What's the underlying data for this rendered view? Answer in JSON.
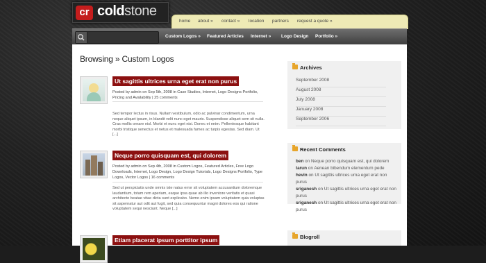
{
  "logo": {
    "mark": "cr",
    "word_a": "cold",
    "word_b": "stone"
  },
  "topnav": [
    "home",
    "about »",
    "contact »",
    "location",
    "partners",
    "request a quote »"
  ],
  "mainnav": [
    "Custom Logos »",
    "Featured Articles",
    "Internet »",
    "Logo Design",
    "Portfolio »"
  ],
  "page_title": "Browsing » Custom Logos",
  "posts": [
    {
      "title": "Ut sagittis ultrices urna eget erat non purus",
      "meta": "Posted by admin on Sep 5th, 2008 in Case Studies, Internet, Logo Designs Portfolio, Pricing and Availability | 25 comments",
      "excerpt": "Sed tempor lectus in risus. Nullam vestibulum, odio ac pulvinar condimentum, urna neque aliquet ipsum, in blandit velit nunc eget mauris. Suspendisse aliquet sem sit nulla. Cras mollis ornare nisl. Morbi et nunc eget nisi. Donec et enim. Pellentesque habitant morbi tristique senectus et netus et malesuada fames ac turpis egestas. Sed diam. Ut [...]"
    },
    {
      "title": "Neque porro quisquam est, qui dolorem",
      "meta": "Posted by admin on Sep 4th, 2008 in Custom Logos, Featured Articles, Free Logo Downloads, Internet, Logo Design, Logo Design Tutorials, Logo Designs Portfolio, Type Logos, Vector Logos | 16 comments",
      "excerpt": "Sed ut perspiciatis unde omnis iste natus error sit voluptatem accusantium doloremque laudantium, totam rem aperiam, eaque ipsa quae ab illo inventore veritatis et quasi architecto beatae vitae dicta sunt explicabo. Nemo enim ipsam voluptatem quia voluptas sit aspernatur aut odit aut fugit, sed quia consequuntur magni dolores eos qui ratione voluptatem sequi nesciunt. Neque [...]"
    },
    {
      "title": "Etiam placerat ipsum porttitor ipsum",
      "meta": "",
      "excerpt": ""
    }
  ],
  "sidebar": {
    "archives_title": "Archives",
    "archives": [
      "September 2008",
      "August 2008",
      "July 2008",
      "January 2008",
      "September 2006"
    ],
    "recent_title": "Recent Comments",
    "recent": [
      {
        "who": "ben",
        "on": "on",
        "what": "Neque porro quisquam est, qui dolorem"
      },
      {
        "who": "tarun",
        "on": "on",
        "what": "Aenean bibendum elementum pede"
      },
      {
        "who": "hevin",
        "on": "on",
        "what": "Ut sagittis ultrices urna eget erat non purus"
      },
      {
        "who": "sriganesh",
        "on": "on",
        "what": "Ut sagittis ultrices urna eget erat non purus"
      },
      {
        "who": "sriganesh",
        "on": "on",
        "what": "Ut sagittis ultrices urna eget erat non purus"
      }
    ],
    "blogroll_title": "Blogroll"
  }
}
